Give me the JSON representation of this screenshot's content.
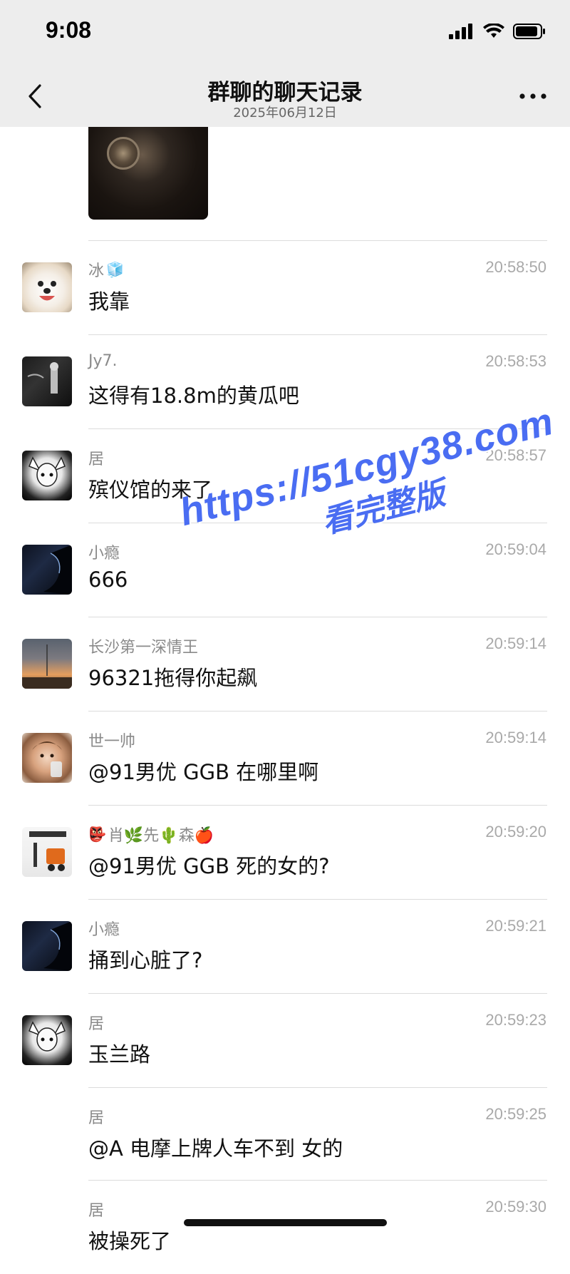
{
  "status_bar": {
    "time": "9:08"
  },
  "nav": {
    "title": "群聊的聊天记录",
    "subtitle": "2025年06月12日"
  },
  "messages": [
    {
      "sender": "冰",
      "sender_suffix": "🧊",
      "time": "20:58:50",
      "text": "我靠",
      "avatar": "dog-avatar"
    },
    {
      "sender": "Jy7.",
      "time": "20:58:53",
      "text": "这得有18.8m的黄瓜吧",
      "avatar": "stage-avatar"
    },
    {
      "sender": "居",
      "time": "20:58:57",
      "text": "殡仪馆的来了",
      "avatar": "anime-avatar"
    },
    {
      "sender": "小瘾",
      "time": "20:59:04",
      "text": "666",
      "avatar": "silhouette-avatar"
    },
    {
      "sender": "长沙第一深情王",
      "time": "20:59:14",
      "text": "96321拖得你起飙",
      "avatar": "sunset-avatar"
    },
    {
      "sender": "世一帅",
      "time": "20:59:14",
      "text": "@91男优 GGB 在哪里啊",
      "avatar": "boy-avatar"
    },
    {
      "sender": "肖🌿先🌵森🍎",
      "sender_prefix": "👺",
      "time": "20:59:20",
      "text": "@91男优 GGB 死的女的?",
      "avatar": "forklift-avatar"
    },
    {
      "sender": "小瘾",
      "time": "20:59:21",
      "text": "捅到心脏了?",
      "avatar": "silhouette-avatar"
    },
    {
      "sender": "居",
      "time": "20:59:23",
      "text": "玉兰路",
      "avatar": "anime-avatar"
    },
    {
      "sender": "居",
      "time": "20:59:25",
      "text": "@A 电摩上牌人车不到 女的",
      "avatar": "none"
    },
    {
      "sender": "居",
      "time": "20:59:30",
      "text": "被操死了",
      "avatar": "none"
    }
  ],
  "watermark": {
    "line1": "https://51cgy38.com",
    "line2": "看完整版"
  },
  "colors": {
    "header_bg": "#ededed",
    "watermark": "#4a6df2",
    "divider": "#dcdcdc"
  }
}
